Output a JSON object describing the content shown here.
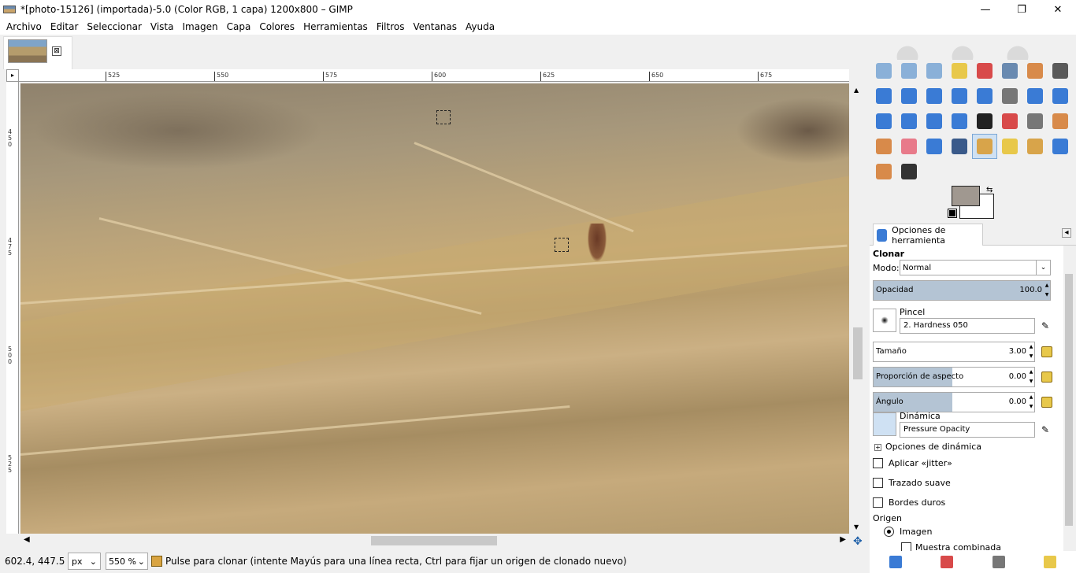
{
  "window": {
    "title": "*[photo-15126] (importada)-5.0 (Color RGB, 1 capa) 1200x800 – GIMP",
    "min": "—",
    "max": "❐",
    "close": "✕"
  },
  "menu": [
    "Archivo",
    "Editar",
    "Seleccionar",
    "Vista",
    "Imagen",
    "Capa",
    "Colores",
    "Herramientas",
    "Filtros",
    "Ventanas",
    "Ayuda"
  ],
  "tab": {
    "close": "⊠"
  },
  "ruler": {
    "h": [
      "525",
      "550",
      "575",
      "600",
      "625",
      "650",
      "675"
    ],
    "v": [
      "4\n5\n0",
      "4\n7\n5",
      "5\n0\n0",
      "5\n2\n5"
    ]
  },
  "status": {
    "coords": "602.4, 447.5",
    "unit": "px",
    "zoom": "550 %",
    "message": "Pulse para clonar (intente Mayús para una línea recta, Ctrl para fijar un origen de clonado nuevo)"
  },
  "tooloptions": {
    "tab_label": "Opciones de herramienta",
    "tool_name": "Clonar",
    "mode_label": "Modo:",
    "mode_value": "Normal",
    "opacity_label": "Opacidad",
    "opacity_value": "100.0",
    "opacity_level": 1.0,
    "brush_label": "Pincel",
    "brush_value": "2. Hardness 050",
    "size_label": "Tamaño",
    "size_value": "3.00",
    "aspect_label": "Proporción de aspecto",
    "aspect_value": "0.00",
    "angle_label": "Ángulo",
    "angle_value": "0.00",
    "dynamics_label": "Dinámica",
    "dynamics_value": "Pressure Opacity",
    "dynamics_options": "Opciones de dinámica",
    "jitter": "Aplicar «jitter»",
    "smooth": "Trazado suave",
    "hard": "Bordes duros",
    "source_label": "Origen",
    "source_image": "Imagen",
    "sample_merged": "Muestra combinada"
  },
  "tools": [
    {
      "name": "rect-select-icon",
      "color": "#8ab0d8"
    },
    {
      "name": "ellipse-select-icon",
      "color": "#8ab0d8"
    },
    {
      "name": "free-select-icon",
      "color": "#8ab0d8"
    },
    {
      "name": "fuzzy-select-icon",
      "color": "#e8c84a"
    },
    {
      "name": "select-by-color-icon",
      "color": "#d84a4a"
    },
    {
      "name": "scissors-icon",
      "color": "#6a8ab0"
    },
    {
      "name": "foreground-select-icon",
      "color": "#d88a4a"
    },
    {
      "name": "paths-icon",
      "color": "#5a5a5a"
    },
    {
      "name": "color-picker-icon",
      "color": "#3a7bd5"
    },
    {
      "name": "zoom-icon",
      "color": "#3a7bd5"
    },
    {
      "name": "measure-icon",
      "color": "#3a7bd5"
    },
    {
      "name": "move-icon",
      "color": "#3a7bd5"
    },
    {
      "name": "align-icon",
      "color": "#3a7bd5"
    },
    {
      "name": "crop-icon",
      "color": "#777"
    },
    {
      "name": "rotate-icon",
      "color": "#3a7bd5"
    },
    {
      "name": "scale-icon",
      "color": "#3a7bd5"
    },
    {
      "name": "shear-icon",
      "color": "#3a7bd5"
    },
    {
      "name": "perspective-icon",
      "color": "#3a7bd5"
    },
    {
      "name": "flip-icon",
      "color": "#3a7bd5"
    },
    {
      "name": "cage-icon",
      "color": "#3a7bd5"
    },
    {
      "name": "text-icon",
      "color": "#222"
    },
    {
      "name": "bucket-fill-icon",
      "color": "#d84a4a"
    },
    {
      "name": "gradient-icon",
      "color": "#777"
    },
    {
      "name": "pencil-icon",
      "color": "#d88a4a"
    },
    {
      "name": "paintbrush-icon",
      "color": "#d88a4a"
    },
    {
      "name": "eraser-icon",
      "color": "#e87a8a"
    },
    {
      "name": "airbrush-icon",
      "color": "#3a7bd5"
    },
    {
      "name": "ink-icon",
      "color": "#3a5a8a"
    },
    {
      "name": "clone-icon",
      "color": "#d8a44a"
    },
    {
      "name": "heal-icon",
      "color": "#e8c84a"
    },
    {
      "name": "perspective-clone-icon",
      "color": "#d8a44a"
    },
    {
      "name": "blur-icon",
      "color": "#3a7bd5"
    },
    {
      "name": "smudge-icon",
      "color": "#d88a4a"
    },
    {
      "name": "dodge-burn-icon",
      "color": "#333"
    }
  ]
}
